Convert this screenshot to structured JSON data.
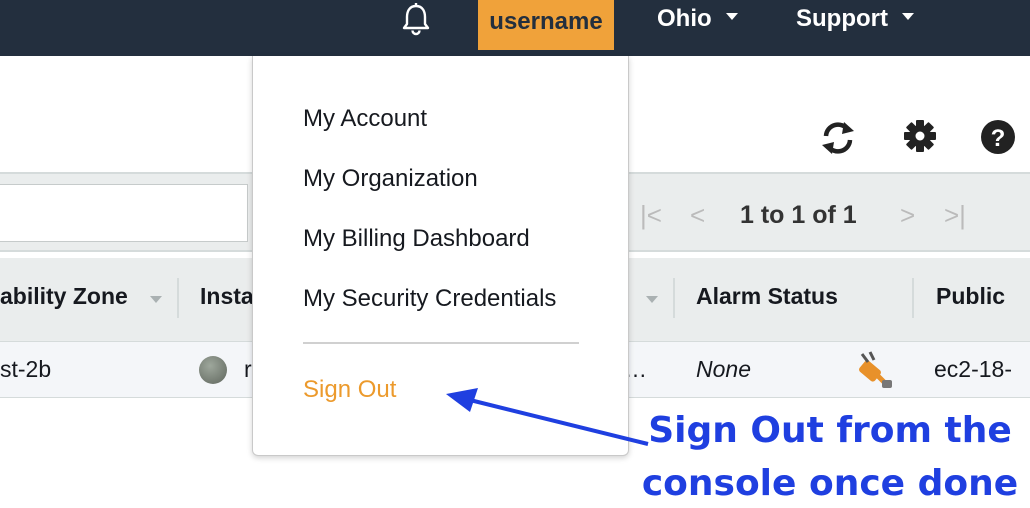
{
  "nav": {
    "username": "username",
    "region": "Ohio",
    "support": "Support"
  },
  "icons": {
    "bell": "bell-icon",
    "refresh": "refresh-icon",
    "settings": "gear-icon",
    "help": "help-icon",
    "instance_state": "state-dot-icon",
    "alarm": "plug-icon"
  },
  "pagination": {
    "text": "1 to 1 of 1",
    "first": "|<",
    "prev": "<",
    "next": ">",
    "last": ">|"
  },
  "table": {
    "columns": [
      "ability Zone",
      "Insta",
      "Alarm Status",
      "Public"
    ],
    "row": {
      "zone": "st-2b",
      "instance_partial": "r",
      "truncated": "…",
      "alarm_status": "None",
      "public": "ec2-18-"
    }
  },
  "menu": {
    "items": [
      "My Account",
      "My Organization",
      "My Billing Dashboard",
      "My Security Credentials"
    ],
    "sign_out": "Sign Out"
  },
  "annotation": {
    "line1": "Sign Out from the",
    "line2": "console once done"
  },
  "colors": {
    "nav_bg": "#232f3e",
    "user_bg": "#f0a23a",
    "sign_out": "#ec9a2c",
    "annotation": "#1f3fe0"
  }
}
